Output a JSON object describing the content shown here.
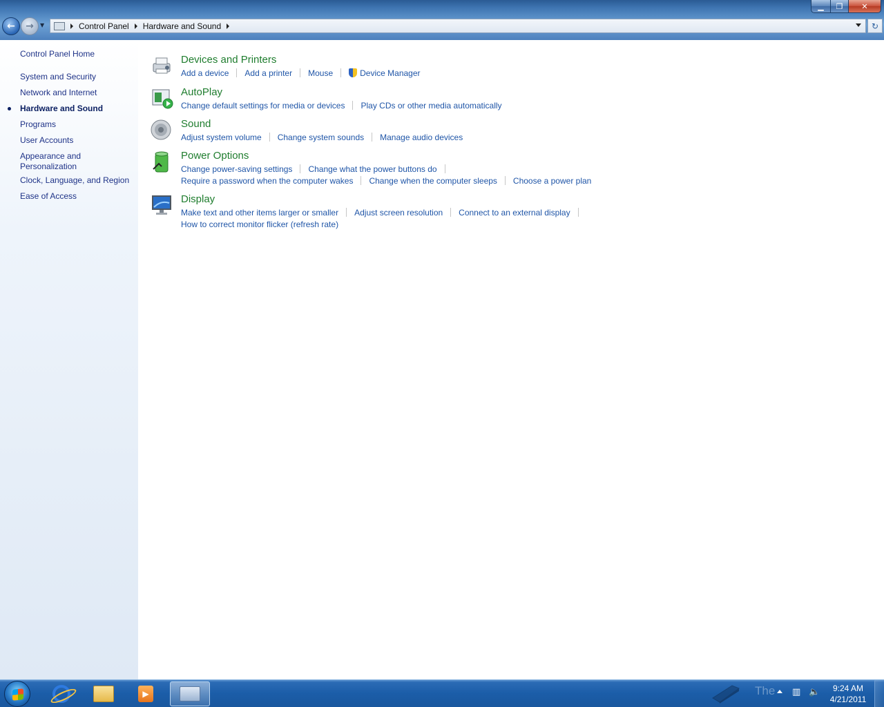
{
  "window": {
    "minimize_icon": "minimize-icon",
    "maximize_icon": "restore-icon",
    "close_icon": "close-icon"
  },
  "nav": {
    "back_icon": "back-arrow-icon",
    "forward_icon": "forward-arrow-icon",
    "breadcrumbs": [
      "Control Panel",
      "Hardware and Sound"
    ]
  },
  "sidebar": {
    "items": [
      {
        "label": "Control Panel Home"
      },
      {
        "label": "System and Security"
      },
      {
        "label": "Network and Internet"
      },
      {
        "label": "Hardware and Sound",
        "active": true
      },
      {
        "label": "Programs"
      },
      {
        "label": "User Accounts"
      },
      {
        "label": "Appearance and\nPersonalization"
      },
      {
        "label": "Clock, Language, and Region"
      },
      {
        "label": "Ease of Access"
      }
    ]
  },
  "categories": [
    {
      "title": "Devices and Printers",
      "icon": "devices-printers-icon",
      "rows": [
        [
          "Add a device",
          "Add a printer",
          "Mouse",
          "Device Manager"
        ]
      ]
    },
    {
      "title": "AutoPlay",
      "icon": "autoplay-icon",
      "rows": [
        [
          "Change default settings for media or devices",
          "Play CDs or other media automatically"
        ]
      ]
    },
    {
      "title": "Sound",
      "icon": "speaker-icon",
      "rows": [
        [
          "Adjust system volume",
          "Change system sounds",
          "Manage audio devices"
        ]
      ]
    },
    {
      "title": "Power Options",
      "icon": "battery-icon",
      "rows": [
        [
          "Change power-saving settings",
          "Change what the power buttons do"
        ],
        [
          "Require a password when the computer wakes",
          "Change when the computer sleeps",
          "Choose a power plan"
        ]
      ]
    },
    {
      "title": "Display",
      "icon": "monitor-icon",
      "rows": [
        [
          "Make text and other items larger or smaller",
          "Adjust screen resolution",
          "Connect to an external display"
        ],
        [
          "How to correct monitor flicker (refresh rate)"
        ]
      ]
    }
  ],
  "taskbar": {
    "start_icon": "windows-start-icon",
    "apps": [
      "internet-explorer-icon",
      "file-explorer-icon",
      "media-player-icon",
      "control-panel-icon"
    ],
    "clock_time": "9:24 AM",
    "clock_date": "4/21/2011",
    "watermark": "The"
  }
}
